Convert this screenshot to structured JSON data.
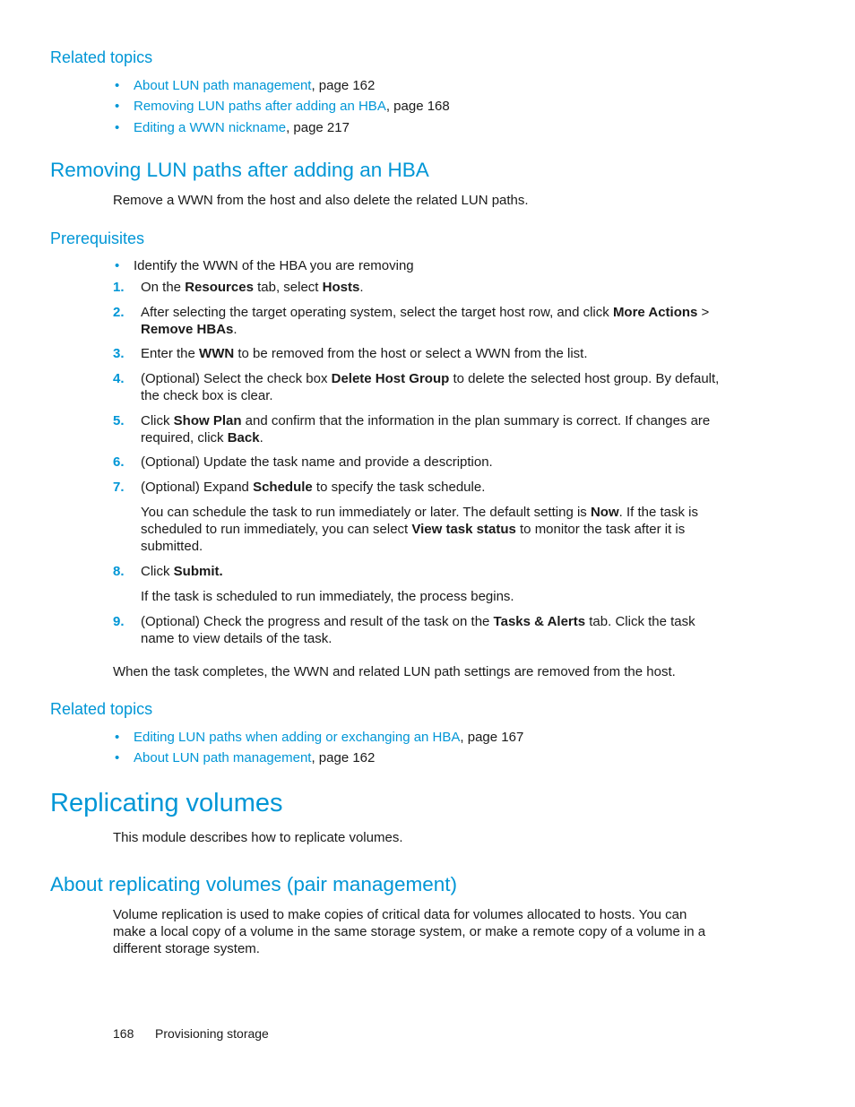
{
  "related_topics_1": {
    "heading": "Related topics",
    "items": [
      {
        "link": "About LUN path management",
        "suffix": ", page 162"
      },
      {
        "link": "Removing LUN paths after adding an HBA",
        "suffix": ", page 168"
      },
      {
        "link": "Editing a WWN nickname",
        "suffix": ", page 217"
      }
    ]
  },
  "removing_section": {
    "heading": "Removing LUN paths after adding an HBA",
    "intro": "Remove a WWN from the host and also delete the related LUN paths.",
    "prerequisites_heading": "Prerequisites",
    "prerequisites": [
      "Identify the WWN of the HBA you are removing"
    ],
    "steps": [
      {
        "num": "1.",
        "parts": [
          "On the ",
          "Resources",
          " tab, select ",
          "Hosts",
          "."
        ]
      },
      {
        "num": "2.",
        "parts": [
          "After selecting the target operating system, select the target host row, and click ",
          "More Actions",
          " > ",
          "Remove HBAs",
          "."
        ]
      },
      {
        "num": "3.",
        "parts": [
          "Enter the ",
          "WWN",
          " to be removed from the host or select a WWN from the list."
        ]
      },
      {
        "num": "4.",
        "parts": [
          "(Optional) Select the check box ",
          "Delete Host Group",
          " to delete the selected host group. By default, the check box is clear."
        ]
      },
      {
        "num": "5.",
        "parts": [
          "Click ",
          "Show Plan",
          " and confirm that the information in the plan summary is correct. If changes are required, click ",
          "Back",
          "."
        ]
      },
      {
        "num": "6.",
        "parts": [
          "(Optional) Update the task name and provide a description."
        ]
      },
      {
        "num": "7.",
        "parts": [
          "(Optional) Expand ",
          "Schedule",
          " to specify the task schedule."
        ]
      },
      {
        "num": "8.",
        "parts": [
          "Click ",
          "Submit."
        ]
      },
      {
        "num": "9.",
        "parts": [
          "(Optional) Check the progress and result of the task on the ",
          "Tasks & Alerts",
          " tab. Click the task name to view details of the task."
        ]
      }
    ],
    "step7_note": [
      "You can schedule the task to run immediately or later. The default setting is ",
      "Now",
      ". If the task is scheduled to run immediately, you can select ",
      "View task status",
      " to monitor the task after it is submitted."
    ],
    "step8_note": "If the task is scheduled to run immediately, the process begins.",
    "completion": "When the task completes, the WWN and related LUN path settings are removed from the host."
  },
  "related_topics_2": {
    "heading": "Related topics",
    "items": [
      {
        "link": "Editing LUN paths when adding or exchanging an HBA",
        "suffix": ", page 167"
      },
      {
        "link": "About LUN path management",
        "suffix": ", page 162"
      }
    ]
  },
  "replicating": {
    "heading": "Replicating volumes",
    "intro": "This module describes how to replicate volumes."
  },
  "about_replicating": {
    "heading": "About replicating volumes (pair management)",
    "body": "Volume replication is used to make copies of critical data for volumes allocated to hosts. You can make a local copy of a volume in the same storage system, or make a remote copy of a volume in a different storage system."
  },
  "footer": {
    "page_number": "168",
    "section": "Provisioning storage"
  },
  "colors": {
    "accent": "#0096d6",
    "text": "#1a1a1a"
  }
}
